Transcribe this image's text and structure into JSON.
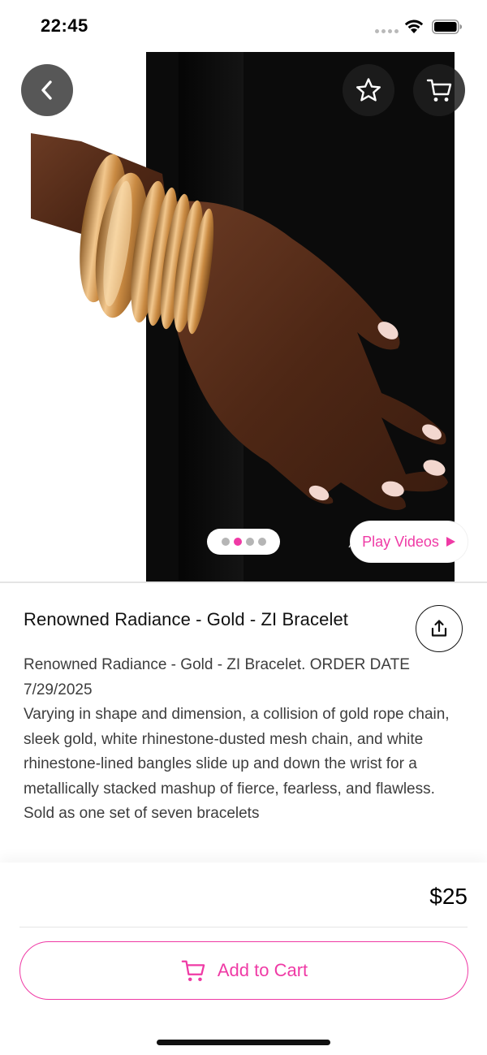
{
  "status_bar": {
    "time": "22:45",
    "icons": [
      "signal-dots-icon",
      "wifi-icon",
      "battery-icon"
    ]
  },
  "header": {
    "back_icon": "chevron-left-icon",
    "favorite_icon": "star-outline-icon",
    "cart_icon": "cart-icon"
  },
  "gallery": {
    "image_count": 4,
    "active_index": 1,
    "play_videos_label": "Play Videos",
    "play_icon": "play-triangle-icon"
  },
  "product": {
    "title": "Renowned Radiance - Gold - ZI Bracelet",
    "share_icon": "share-icon",
    "description": "Renowned Radiance - Gold - ZI Bracelet. ORDER DATE 7/29/2025\nVarying in shape and dimension, a collision of gold rope chain, sleek gold, white rhinestone-dusted mesh chain, and white rhinestone-lined bangles slide up and down the wrist for a metallically stacked mashup of fierce, fearless, and flawless.\n Sold as one set of seven bracelets",
    "price": "$25"
  },
  "actions": {
    "add_to_cart_label": "Add to Cart",
    "add_to_cart_icon": "cart-icon"
  },
  "colors": {
    "accent": "#ef3aa5",
    "text_primary": "#111111",
    "text_secondary": "#3d3d3d"
  }
}
